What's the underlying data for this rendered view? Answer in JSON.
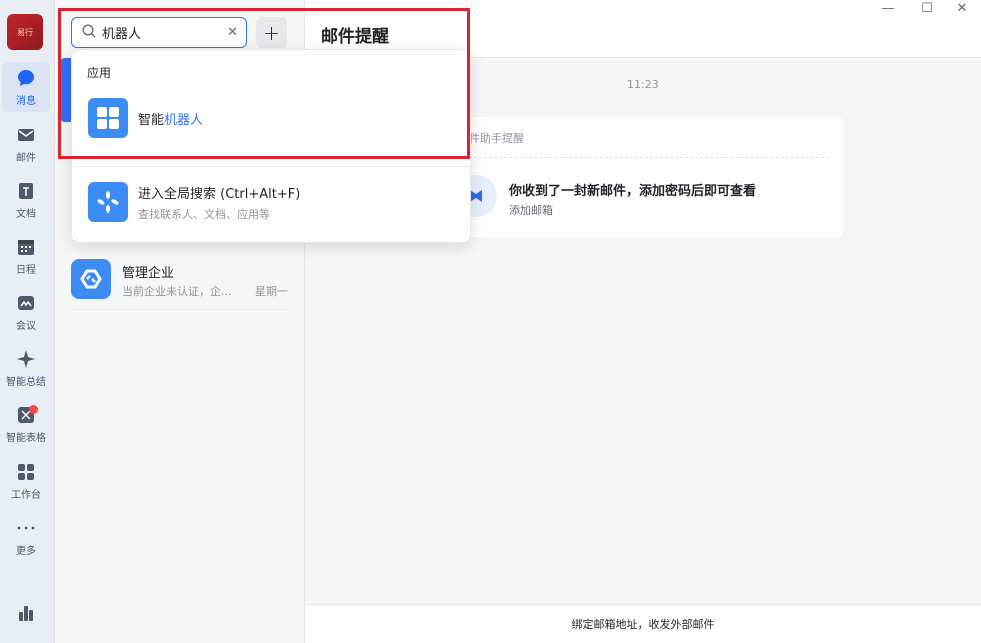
{
  "sidebar": {
    "avatar_text": "易行",
    "items": [
      {
        "label": "消息",
        "icon": "message-icon",
        "active": true
      },
      {
        "label": "邮件",
        "icon": "mail-icon"
      },
      {
        "label": "文档",
        "icon": "doc-icon"
      },
      {
        "label": "日程",
        "icon": "calendar-icon"
      },
      {
        "label": "会议",
        "icon": "meeting-icon"
      },
      {
        "label": "智能总结",
        "icon": "sparkle-icon"
      },
      {
        "label": "智能表格",
        "icon": "smart-table-icon",
        "badge": true
      },
      {
        "label": "工作台",
        "icon": "workbench-icon"
      },
      {
        "label": "更多",
        "icon": "more-icon"
      }
    ],
    "bottom_icon": "stats-icon"
  },
  "search": {
    "value": "机器人",
    "clear_icon": "close-icon",
    "add_icon": "plus-icon"
  },
  "dropdown": {
    "section_label": "应用",
    "app_result": {
      "prefix": "智能",
      "highlight": "机器人"
    },
    "global_search": {
      "title": "进入全局搜索 (Ctrl+Alt+F)",
      "subtitle": "查找联系人、文档、应用等"
    }
  },
  "sessions": [
    {
      "title": "管理企业",
      "subtitle": "当前企业未认证，企...",
      "time": "星期一"
    }
  ],
  "chat": {
    "title": "邮件提醒",
    "timestamp": "11:23",
    "card": {
      "header": "件助手提醒",
      "message": "你收到了一封新邮件，添加密码后即可查看",
      "link": "添加邮箱"
    },
    "footer": "绑定邮箱地址，收发外部邮件"
  },
  "colors": {
    "accent": "#3370ff",
    "highlight_frame": "#d9262e",
    "badge": "#f54a45"
  }
}
